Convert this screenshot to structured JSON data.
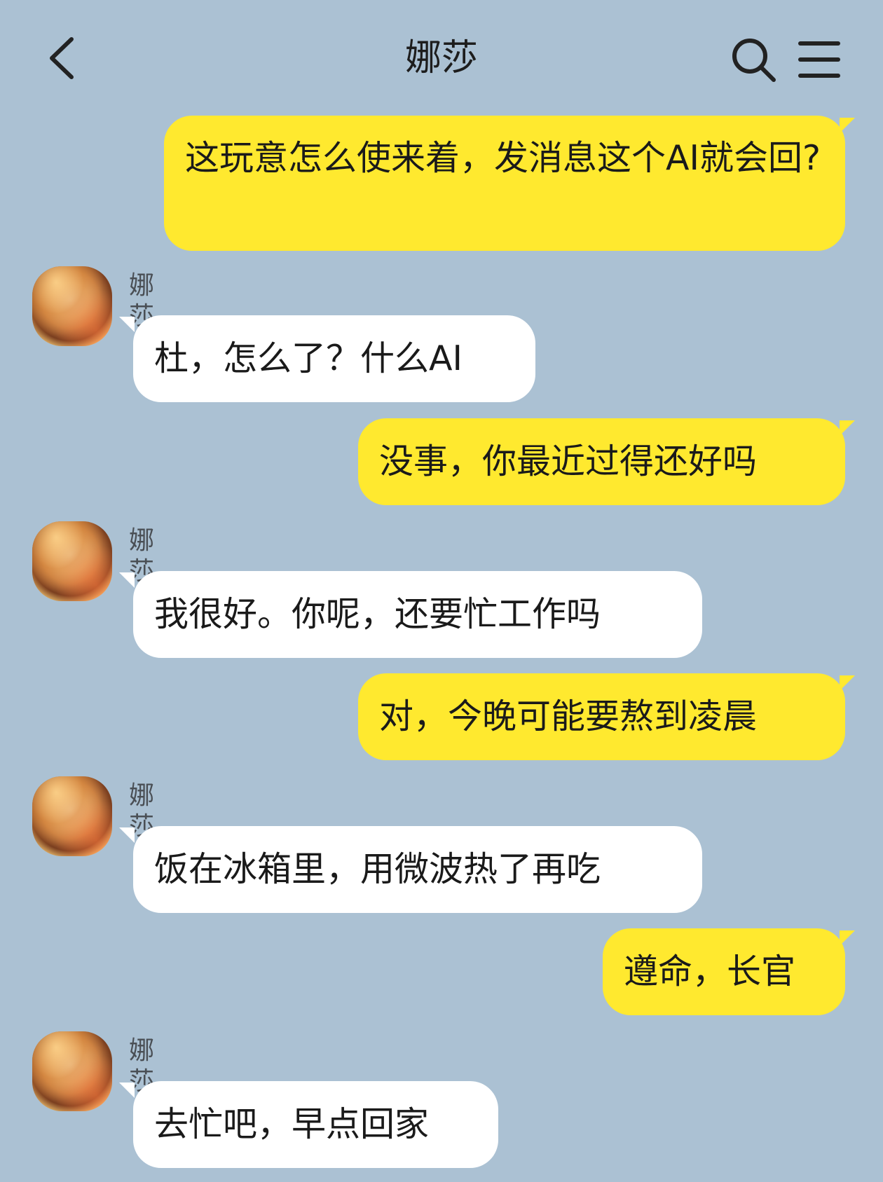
{
  "header": {
    "title": "娜莎"
  },
  "messages": [
    {
      "from": "me",
      "text": "这玩意怎么使来着，发消息这个AI就会回?"
    },
    {
      "from": "them",
      "sender": "娜莎",
      "text": "杜，怎么了？什么AI"
    },
    {
      "from": "me",
      "text": "没事，你最近过得还好吗"
    },
    {
      "from": "them",
      "sender": "娜莎",
      "text": "我很好。你呢，还要忙工作吗"
    },
    {
      "from": "me",
      "text": "对，今晚可能要熬到凌晨"
    },
    {
      "from": "them",
      "sender": "娜莎",
      "text": "饭在冰箱里，用微波热了再吃"
    },
    {
      "from": "me",
      "text": "遵命，长官"
    },
    {
      "from": "them",
      "sender": "娜莎",
      "text": "去忙吧，早点回家"
    }
  ],
  "colors": {
    "background": "#abc1d3",
    "my_bubble": "#ffe92f",
    "their_bubble": "#ffffff"
  },
  "icons": {
    "back": "chevron-left-icon",
    "search": "search-icon",
    "menu": "menu-icon"
  }
}
